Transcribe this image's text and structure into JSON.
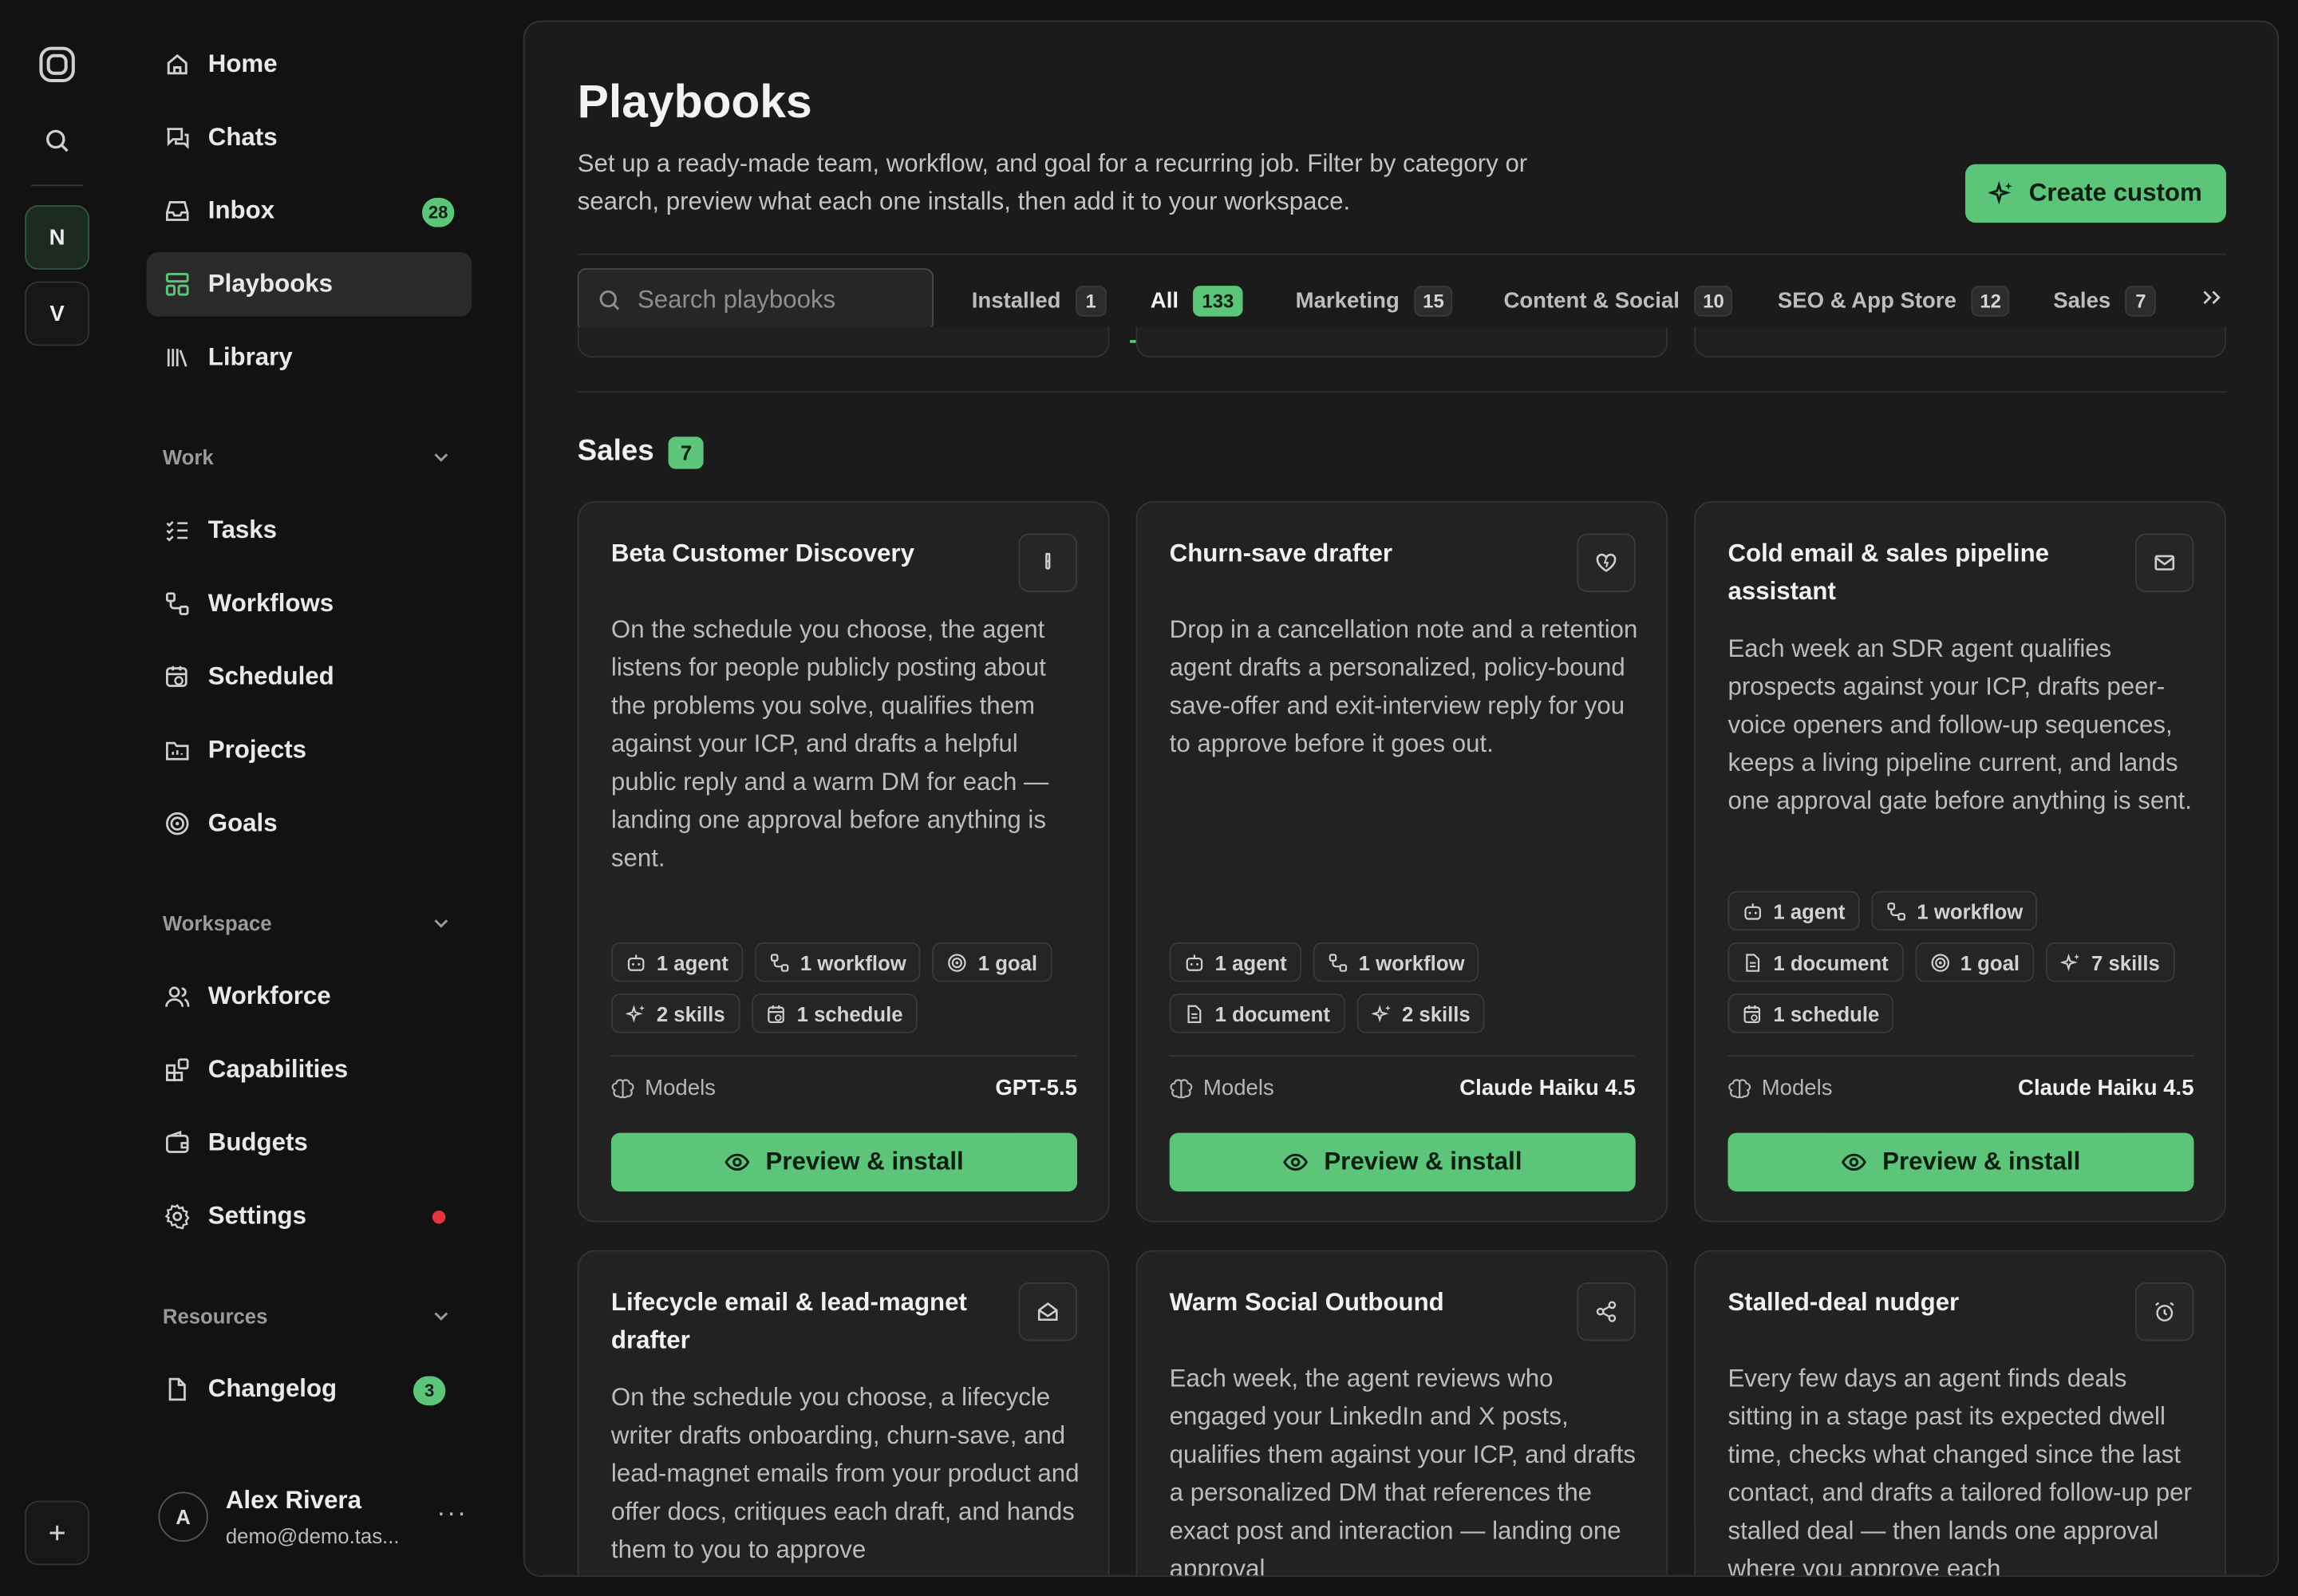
{
  "accent": "#5cc57a",
  "rail": {
    "workspaces": [
      "N",
      "V"
    ]
  },
  "nav": {
    "home": "Home",
    "chats": "Chats",
    "inbox": "Inbox",
    "inbox_badge": "28",
    "playbooks": "Playbooks",
    "library": "Library",
    "work_section": "Work",
    "tasks": "Tasks",
    "workflows": "Workflows",
    "scheduled": "Scheduled",
    "projects": "Projects",
    "goals": "Goals",
    "workspace_section": "Workspace",
    "workforce": "Workforce",
    "capabilities": "Capabilities",
    "budgets": "Budgets",
    "settings": "Settings",
    "resources_section": "Resources",
    "changelog": "Changelog",
    "changelog_badge": "3"
  },
  "user": {
    "initial": "A",
    "name": "Alex Rivera",
    "email": "demo@demo.tas...",
    "more": "···"
  },
  "header": {
    "title": "Playbooks",
    "description": "Set up a ready-made team, workflow, and goal for a recurring job. Filter by category or search, preview what each one installs, then add it to your workspace.",
    "create_label": "Create custom"
  },
  "search": {
    "placeholder": "Search playbooks"
  },
  "tabs": [
    {
      "label": "Installed",
      "count": "1"
    },
    {
      "label": "All",
      "count": "133"
    },
    {
      "label": "Marketing",
      "count": "15"
    },
    {
      "label": "Content & Social",
      "count": "10"
    },
    {
      "label": "SEO & App Store",
      "count": "12"
    },
    {
      "label": "Sales",
      "count": "7"
    }
  ],
  "section": {
    "title": "Sales",
    "count": "7"
  },
  "cards": [
    {
      "title": "Beta Customer Discovery",
      "icon": "flask-icon",
      "description": "On the schedule you choose, the agent listens for people publicly posting about the problems you solve, qualifies them against your ICP, and drafts a helpful public reply and a warm DM for each — landing one approval before anything is sent.",
      "tags": [
        "1 agent",
        "1 workflow",
        "1 goal",
        "2 skills",
        "1 schedule"
      ],
      "models_label": "Models",
      "model": "GPT-5.5",
      "action": "Preview & install"
    },
    {
      "title": "Churn-save drafter",
      "icon": "heart-icon",
      "description": "Drop in a cancellation note and a retention agent drafts a personalized, policy-bound save-offer and exit-interview reply for you to approve before it goes out.",
      "tags": [
        "1 agent",
        "1 workflow",
        "1 document",
        "2 skills"
      ],
      "models_label": "Models",
      "model": "Claude Haiku 4.5",
      "action": "Preview & install"
    },
    {
      "title": "Cold email & sales pipeline assistant",
      "icon": "mail-icon",
      "description": "Each week an SDR agent qualifies prospects against your ICP, drafts peer-voice openers and follow-up sequences, keeps a living pipeline current, and lands one approval gate before anything is sent.",
      "tags": [
        "1 agent",
        "1 workflow",
        "1 document",
        "1 goal",
        "7 skills",
        "1 schedule"
      ],
      "models_label": "Models",
      "model": "Claude Haiku 4.5",
      "action": "Preview & install"
    },
    {
      "title": "Lifecycle email & lead-magnet drafter",
      "icon": "mail-open-icon",
      "description": "On the schedule you choose, a lifecycle writer drafts onboarding, churn-save, and lead-magnet emails from your product and offer docs, critiques each draft, and hands them to you to approve"
    },
    {
      "title": "Warm Social Outbound",
      "icon": "share-icon",
      "description": "Each week, the agent reviews who engaged your LinkedIn and X posts, qualifies them against your ICP, and drafts a personalized DM that references the exact post and interaction — landing one approval"
    },
    {
      "title": "Stalled-deal nudger",
      "icon": "alarm-icon",
      "description": "Every few days an agent finds deals sitting in a stage past its expected dwell time, checks what changed since the last contact, and drafts a tailored follow-up per stalled deal — then lands one approval where you approve each"
    }
  ]
}
